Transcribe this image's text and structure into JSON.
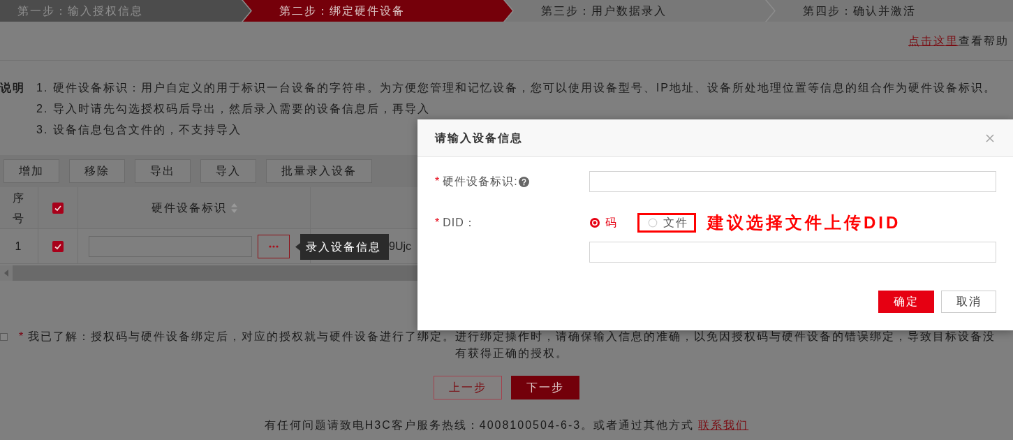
{
  "steps": [
    {
      "label": "第一步：输入授权信息",
      "selected": false,
      "completed": true
    },
    {
      "label": "第二步：绑定硬件设备",
      "selected": true,
      "completed": false
    },
    {
      "label": "第三步：用户数据录入",
      "selected": false,
      "completed": false
    },
    {
      "label": "第四步：确认并激活",
      "selected": false,
      "completed": false
    }
  ],
  "help": {
    "link": "点击这里",
    "text": "查看帮助"
  },
  "notes": {
    "title": "说明",
    "items": [
      "1. 硬件设备标识：用户自定义的用于标识一台设备的字符串。为方便您管理和记忆设备，您可以使用设备型号、IP地址、设备所处地理位置等信息的组合作为硬件设备标识。",
      "2. 导入时请先勾选授权码后导出，然后录入需要的设备信息后，再导入",
      "3. 设备信息包含文件的，不支持导入"
    ]
  },
  "toolbar": {
    "buttons": [
      "增加",
      "移除",
      "导出",
      "导入",
      "批量录入设备"
    ]
  },
  "table": {
    "columns": [
      {
        "kind": "text",
        "label": "序号"
      },
      {
        "kind": "checkbox",
        "checked": true
      },
      {
        "kind": "text",
        "label": "硬件设备标识",
        "sortable": true
      }
    ],
    "rows": [
      {
        "index": "1",
        "checked": true,
        "tooltip": "录入设备信息",
        "column_4": "9Ujc"
      }
    ]
  },
  "agreement": {
    "checked": false,
    "marker": "*",
    "text": "我已了解：授权码与硬件设备绑定后，对应的授权就与硬件设备进行了绑定。进行绑定操作时，请确保输入信息的准确，以免因授权码与硬件设备的错误绑定，导致目标设备没有获得正确的授权。"
  },
  "nav_buttons": [
    {
      "label": "上一步",
      "kind": "secondary"
    },
    {
      "label": "下一步",
      "kind": "primary"
    }
  ],
  "footer": {
    "text": "有任何问题请致电H3C客户服务热线：4008100504-6-3。或者通过其他方式",
    "link": "联系我们"
  },
  "dialog": {
    "title": "请输入设备信息",
    "fields": [
      {
        "kind": "text",
        "marker": "*",
        "label": "硬件设备标识:",
        "help": true
      },
      {
        "kind": "radio_text",
        "marker": "*",
        "label": "DID：",
        "options": [
          {
            "label": "码",
            "selected": true,
            "highlighted": false
          },
          {
            "label": "文件",
            "selected": false,
            "highlighted": true
          }
        ],
        "annotation": "建议选择文件上传DID"
      }
    ],
    "buttons": [
      {
        "label": "确定",
        "kind": "primary"
      },
      {
        "label": "取消",
        "kind": "secondary"
      }
    ]
  }
}
